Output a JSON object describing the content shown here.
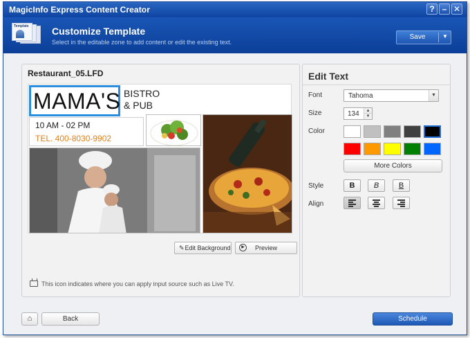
{
  "window": {
    "title": "MagicInfo Express Content Creator"
  },
  "header": {
    "title": "Customize Template",
    "subtitle": "Select in the editable zone to add content or edit the existing text.",
    "save_label": "Save",
    "icon_label": "Template"
  },
  "editor": {
    "file_name": "Restaurant_05.LFD",
    "template": {
      "logo_text": "MAMA'S",
      "tagline": "BISTRO\n& PUB",
      "hours": "10 AM - 02 PM",
      "tel": "TEL. 400-8030-9902"
    },
    "edit_background_label": "Edit Background",
    "preview_label": "Preview",
    "tv_note": "This icon indicates where you can apply input source such as Live TV."
  },
  "edit_text": {
    "title": "Edit Text",
    "font_label": "Font",
    "font_value": "Tahoma",
    "size_label": "Size",
    "size_value": "134",
    "color_label": "Color",
    "colors": [
      "#ffffff",
      "#c0c0c0",
      "#808080",
      "#404040",
      "#000000",
      "#ff0000",
      "#ff9900",
      "#ffff00",
      "#008000",
      "#0066ff"
    ],
    "selected_color": "#000000",
    "more_colors_label": "More Colors",
    "style_label": "Style",
    "style_buttons": [
      "B",
      "B",
      "B"
    ],
    "align_label": "Align",
    "align_buttons": [
      "align-left",
      "align-center",
      "align-right"
    ]
  },
  "footer": {
    "back_label": "Back",
    "schedule_label": "Schedule"
  }
}
